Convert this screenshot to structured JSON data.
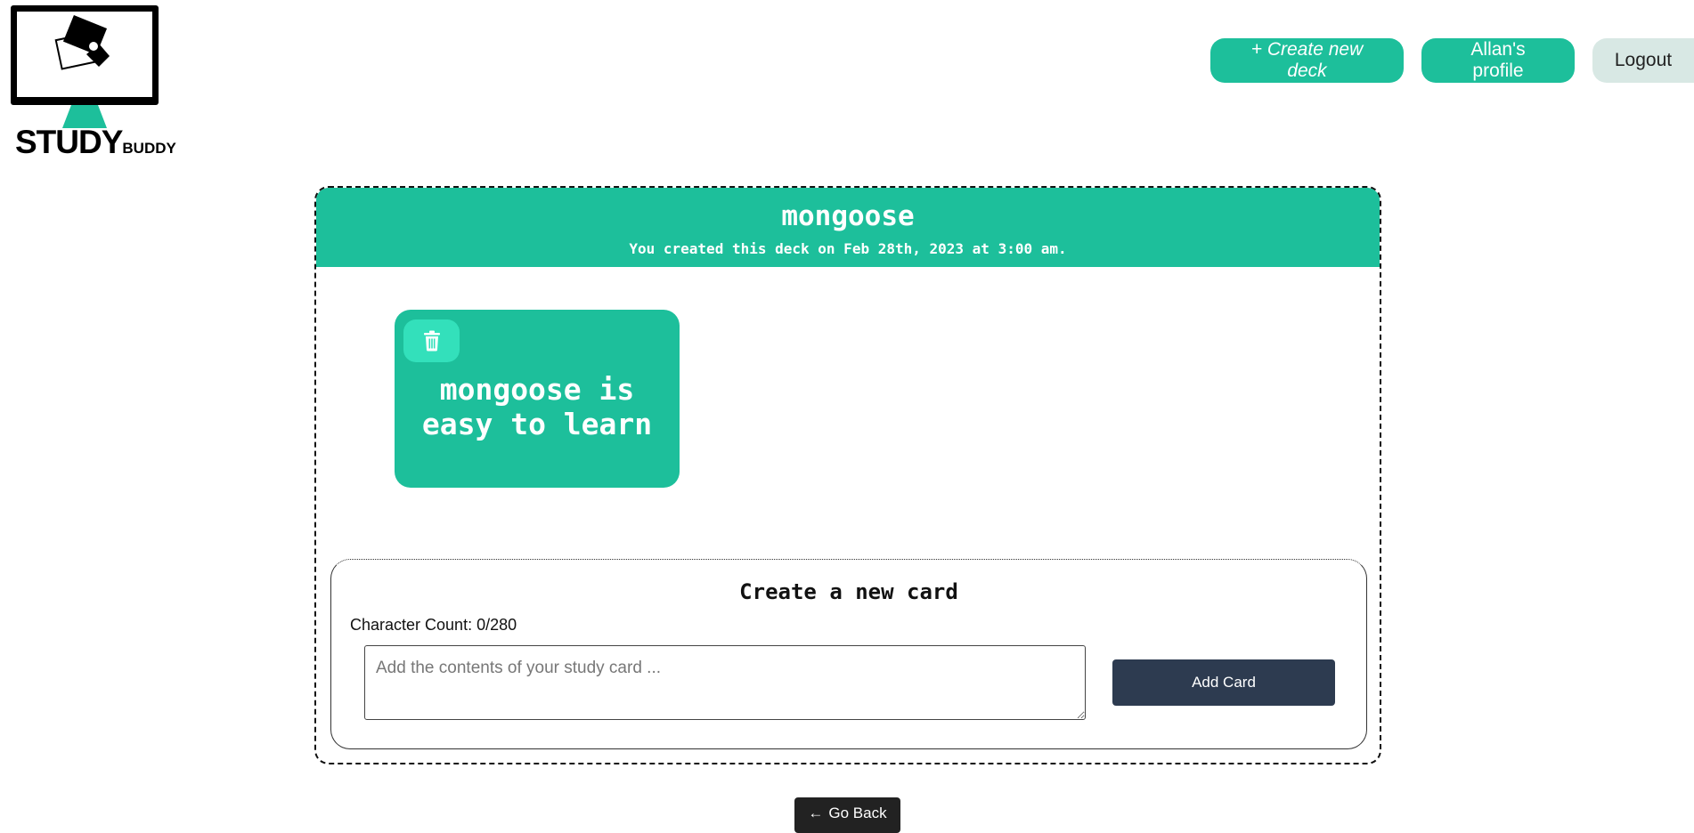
{
  "header": {
    "logo_big": "STUDY",
    "logo_small": "BUDDY",
    "nav": {
      "create_deck_label": "+ Create new deck",
      "profile_label": "Allan's profile",
      "logout_label": "Logout"
    }
  },
  "deck": {
    "title": "mongoose",
    "created_text": "You created this deck on Feb 28th, 2023 at 3:00 am.",
    "cards": [
      {
        "text": "mongoose is easy to learn"
      }
    ]
  },
  "create_card": {
    "title": "Create a new card",
    "char_count_label": "Character Count: 0/280",
    "textarea_placeholder": "Add the contents of your study card ...",
    "textarea_value": "",
    "add_button_label": "Add Card"
  },
  "footer": {
    "go_back_label": "Go Back"
  },
  "colors": {
    "accent": "#1dbf9b",
    "accent_light": "#33e0bb",
    "logout_bg": "#d8e8e4",
    "dark_button": "#2d3b50"
  }
}
